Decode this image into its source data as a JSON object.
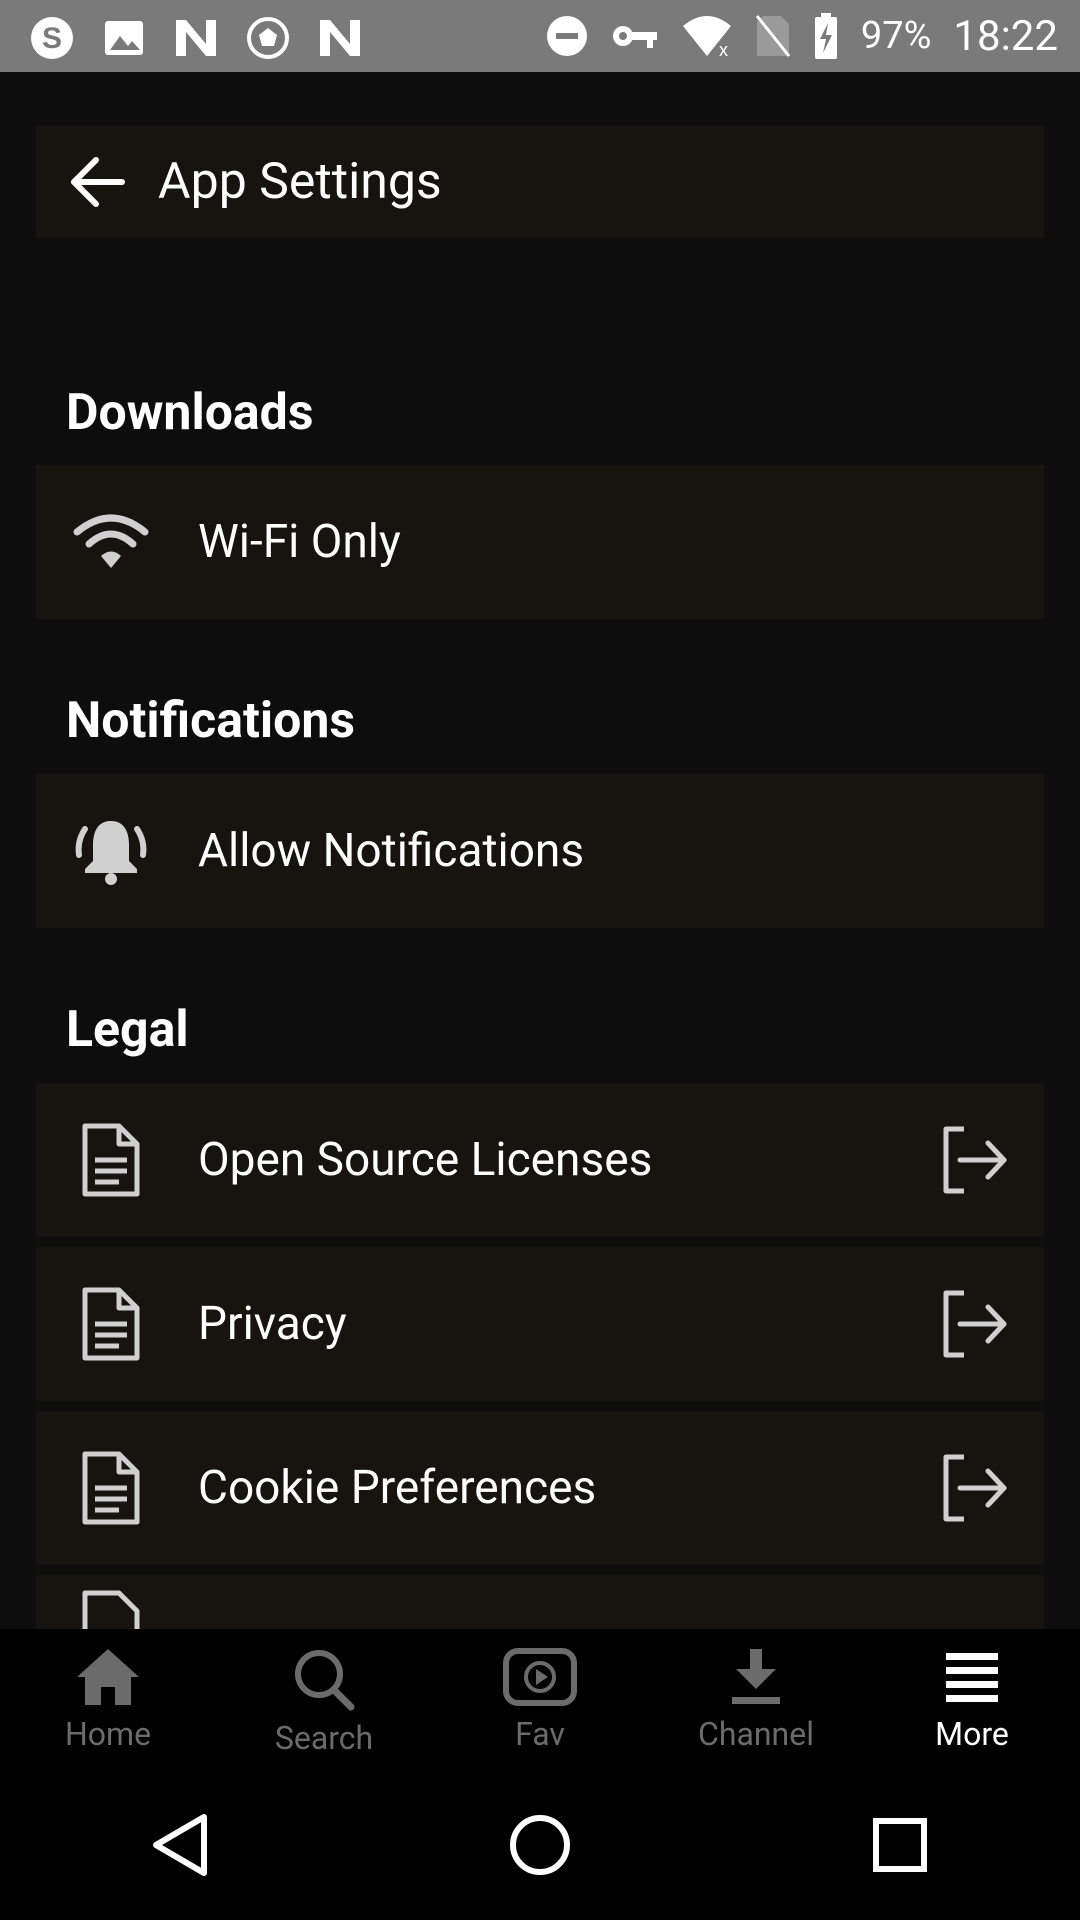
{
  "status_bar": {
    "left_icons": [
      "skype-icon",
      "image-icon",
      "n-app-icon",
      "soccer-icon",
      "n-app-icon"
    ],
    "right_icons": [
      "dnd-icon",
      "vpn-key-icon",
      "wifi-icon",
      "no-sim-icon",
      "battery-charging-icon"
    ],
    "battery": "97%",
    "time": "18:22"
  },
  "header": {
    "title": "App Settings",
    "back_icon": "arrow-back-icon"
  },
  "sections": {
    "downloads": {
      "title": "Downloads",
      "items": [
        {
          "label": "Wi-Fi Only",
          "icon": "wifi-icon"
        }
      ]
    },
    "notifications": {
      "title": "Notifications",
      "items": [
        {
          "label": "Allow Notifications",
          "icon": "bell-ringing-icon"
        }
      ]
    },
    "legal": {
      "title": "Legal",
      "items": [
        {
          "label": "Open Source Licenses",
          "icon": "document-icon",
          "trailing_icon": "external-link-icon"
        },
        {
          "label": "Privacy",
          "icon": "document-icon",
          "trailing_icon": "external-link-icon"
        },
        {
          "label": "Cookie Preferences",
          "icon": "document-icon",
          "trailing_icon": "external-link-icon"
        }
      ]
    }
  },
  "bottom_nav": {
    "items": [
      {
        "label": "Home",
        "icon": "home-icon"
      },
      {
        "label": "Search",
        "icon": "search-icon"
      },
      {
        "label": "Fav",
        "icon": "play-box-icon"
      },
      {
        "label": "Channel",
        "icon": "download-icon"
      },
      {
        "label": "More",
        "icon": "menu-icon"
      }
    ],
    "active": "More"
  },
  "system_nav": [
    "back-triangle-icon",
    "home-circle-icon",
    "recents-square-icon"
  ],
  "colors": {
    "background": "#0d0d0e",
    "card": "#17140f",
    "status_bar": "#7a7a7a",
    "inactive_nav": "#6b6b6b"
  }
}
